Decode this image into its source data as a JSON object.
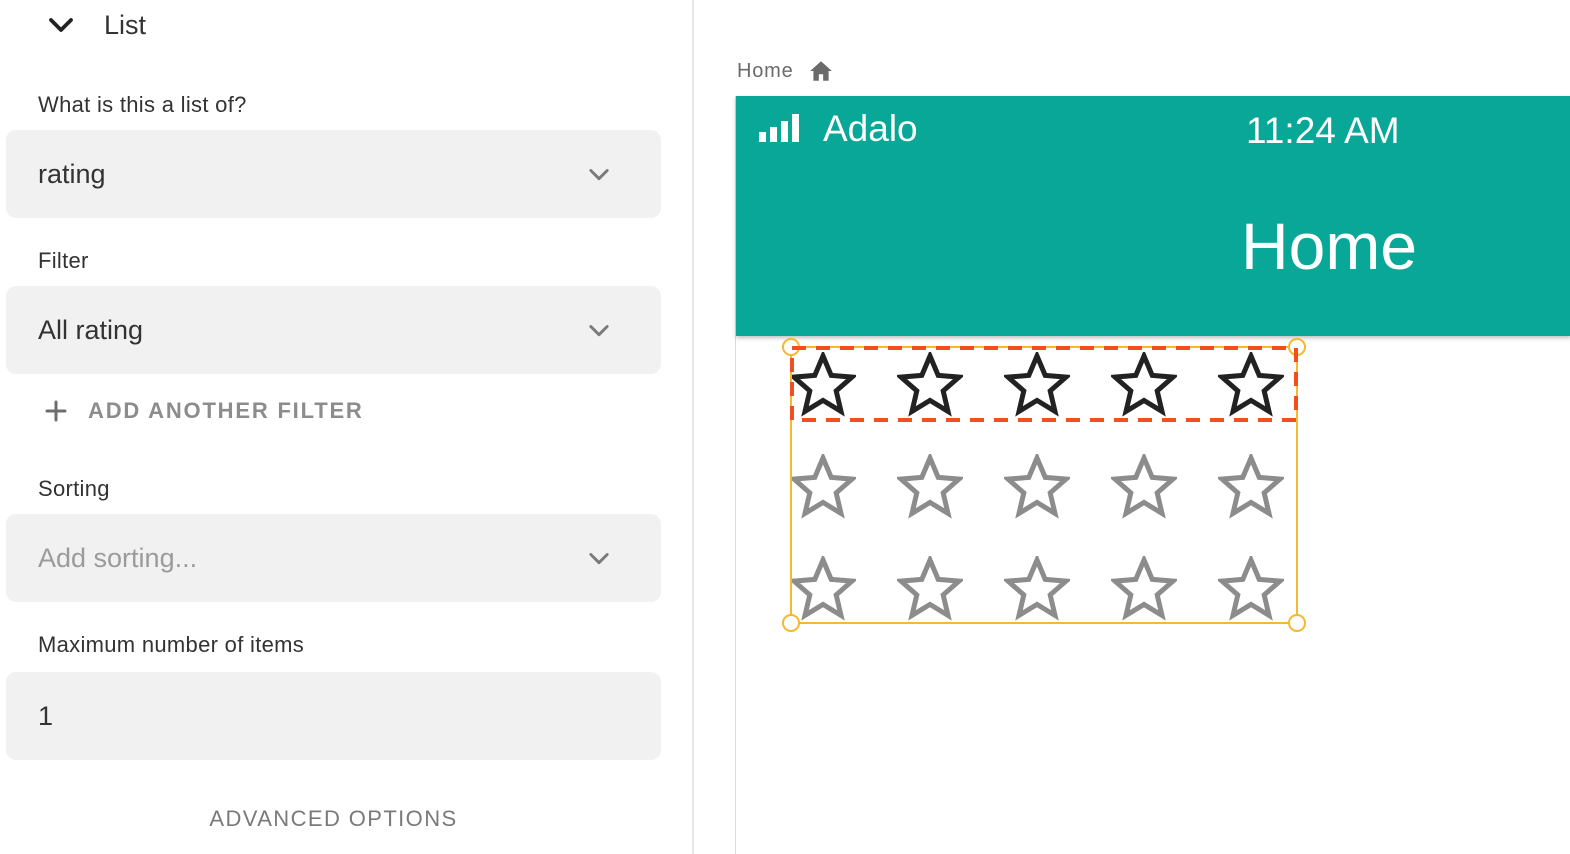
{
  "panel": {
    "section_title": "List",
    "list_of": {
      "label": "What is this a list of?",
      "value": "rating"
    },
    "filter": {
      "label": "Filter",
      "value": "All rating"
    },
    "add_filter_label": "ADD ANOTHER FILTER",
    "sorting": {
      "label": "Sorting",
      "placeholder": "Add sorting..."
    },
    "max_items": {
      "label": "Maximum number of items",
      "value": "1"
    },
    "advanced_label": "ADVANCED OPTIONS"
  },
  "canvas": {
    "breadcrumb": "Home",
    "status_bar": {
      "carrier": "Adalo",
      "time": "11:24 AM"
    },
    "screen_title": "Home",
    "rating_rows": [
      {
        "stars": 5,
        "style": "dark"
      },
      {
        "stars": 5,
        "style": "gray"
      },
      {
        "stars": 5,
        "style": "gray"
      }
    ]
  },
  "colors": {
    "header_bg": "#09a798",
    "selection": "#f5b82e",
    "item_selection": "#f24e1e",
    "star_dark": "#222222",
    "star_gray": "#8c8c8c"
  }
}
